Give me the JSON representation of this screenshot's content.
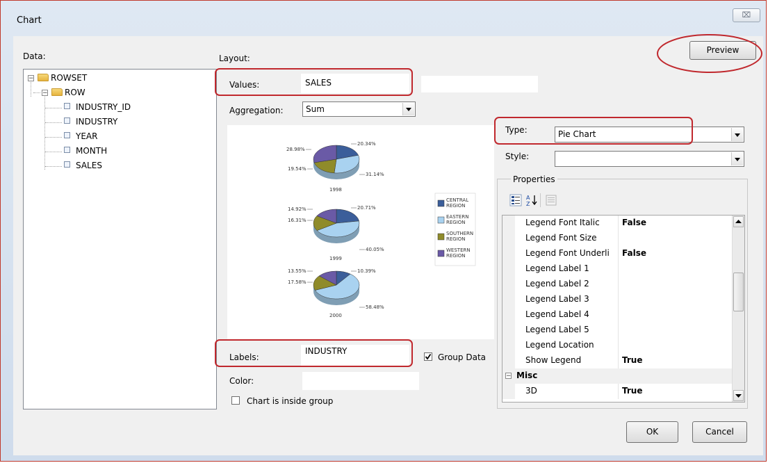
{
  "window": {
    "title": "Chart",
    "close_glyph": "⌧"
  },
  "data_panel": {
    "label": "Data:",
    "tree": [
      {
        "label": "ROWSET",
        "type": "folder",
        "expanded": true,
        "toggle": "−"
      },
      {
        "label": "ROW",
        "type": "folder",
        "expanded": true,
        "toggle": "−"
      },
      {
        "label": "INDUSTRY_ID",
        "type": "field"
      },
      {
        "label": "INDUSTRY",
        "type": "field"
      },
      {
        "label": "YEAR",
        "type": "field"
      },
      {
        "label": "MONTH",
        "type": "field"
      },
      {
        "label": "SALES",
        "type": "field"
      }
    ]
  },
  "layout": {
    "label": "Layout:",
    "preview_button": "Preview",
    "values_label": "Values:",
    "values_value": "SALES",
    "aggregation_label": "Aggregation:",
    "aggregation_value": "Sum",
    "type_label": "Type:",
    "type_value": "Pie Chart",
    "style_label": "Style:",
    "style_value": "",
    "labels_label": "Labels:",
    "labels_value": "INDUSTRY",
    "group_data_label": "Group Data",
    "group_data_checked": true,
    "color_label": "Color:",
    "color_value": "",
    "inside_group_label": "Chart is inside group",
    "inside_group_checked": false
  },
  "chart_data": {
    "type": "pie",
    "title": "",
    "groups": [
      {
        "label": "1998",
        "values": [
          20.34,
          31.14,
          19.54,
          28.98
        ],
        "labels": [
          "20.34%",
          "31.14%",
          "19.54%",
          "28.98%"
        ]
      },
      {
        "label": "1999",
        "values": [
          20.71,
          40.05,
          16.31,
          14.92
        ],
        "labels": [
          "20.71%",
          "40.05%",
          "16.31%",
          "14.92%"
        ]
      },
      {
        "label": "2000",
        "values": [
          10.39,
          58.48,
          17.58,
          13.55
        ],
        "labels": [
          "10.39%",
          "58.48%",
          "17.58%",
          "13.55%"
        ]
      }
    ],
    "legend": [
      {
        "line1": "CENTRAL",
        "line2": "REGION",
        "color": "#3b5e9a"
      },
      {
        "line1": "EASTERN",
        "line2": "REGION",
        "color": "#a9d2f0"
      },
      {
        "line1": "SOUTHERN",
        "line2": "REGION",
        "color": "#8f8b2a"
      },
      {
        "line1": "WESTERN",
        "line2": "REGION",
        "color": "#6a5aa6"
      }
    ],
    "legend_position": "right"
  },
  "properties": {
    "label": "Properties",
    "rows": [
      {
        "name": "Legend Font Italic",
        "value": "False"
      },
      {
        "name": "Legend Font Size",
        "value": ""
      },
      {
        "name": "Legend Font Underli",
        "value": "False"
      },
      {
        "name": "Legend Label 1",
        "value": ""
      },
      {
        "name": "Legend Label 2",
        "value": ""
      },
      {
        "name": "Legend Label 3",
        "value": ""
      },
      {
        "name": "Legend Label 4",
        "value": ""
      },
      {
        "name": "Legend Label 5",
        "value": ""
      },
      {
        "name": "Legend Location",
        "value": ""
      },
      {
        "name": "Show Legend",
        "value": "True"
      }
    ],
    "category": {
      "toggle": "−",
      "name": "Misc"
    },
    "last_row": {
      "name": "3D",
      "value": "True"
    }
  },
  "footer": {
    "ok_label": "OK",
    "cancel_label": "Cancel"
  },
  "colors": {
    "highlight_red": "#c0282d",
    "frame_red": "#c0392b"
  }
}
